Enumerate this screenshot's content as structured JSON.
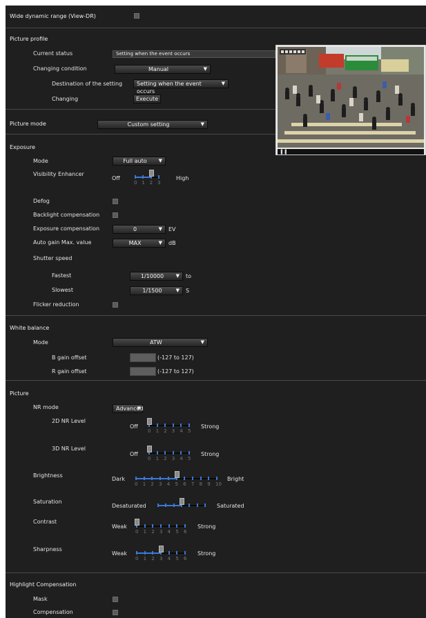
{
  "wdr": {
    "label": "Wide dynamic range (View-DR)"
  },
  "picture_profile": {
    "heading": "Picture profile",
    "current_status_label": "Current status",
    "current_status_value": "Setting when the event occurs",
    "changing_condition_label": "Changing condition",
    "changing_condition_value": "Manual",
    "destination_label": "Destination of the setting",
    "destination_value": "Setting when the event occurs",
    "changing_label": "Changing",
    "execute_button": "Execute"
  },
  "picture_mode": {
    "label": "Picture mode",
    "value": "Custom setting"
  },
  "exposure": {
    "heading": "Exposure",
    "mode_label": "Mode",
    "mode_value": "Full auto",
    "visibility_label": "Visibility Enhancer",
    "visibility_min": "Off",
    "visibility_max": "High",
    "visibility_value": 2,
    "visibility_max_value": 3,
    "defog_label": "Defog",
    "backlight_label": "Backlight compensation",
    "exp_comp_label": "Exposure compensation",
    "exp_comp_value": "0",
    "exp_comp_unit": "EV",
    "agc_label": "Auto gain Max. value",
    "agc_value": "MAX",
    "agc_unit": "dB",
    "shutter_label": "Shutter speed",
    "fastest_label": "Fastest",
    "fastest_value": "1/10000",
    "fastest_unit": "to",
    "slowest_label": "Slowest",
    "slowest_value": "1/1500",
    "slowest_unit": "S",
    "flicker_label": "Flicker reduction"
  },
  "white_balance": {
    "heading": "White balance",
    "mode_label": "Mode",
    "mode_value": "ATW",
    "b_gain_label": "B gain offset",
    "r_gain_label": "R gain offset",
    "range_text": "(-127 to 127)"
  },
  "picture": {
    "heading": "Picture",
    "nr_mode_label": "NR mode",
    "nr_mode_value": "Advanced",
    "nr2d_label": "2D NR Level",
    "nr2d_min": "Off",
    "nr2d_max": "Strong",
    "nr2d_value": 0,
    "nr2d_max_value": 5,
    "nr3d_label": "3D NR Level",
    "nr3d_min": "Off",
    "nr3d_max": "Strong",
    "nr3d_value": 0,
    "nr3d_max_value": 5,
    "brightness_label": "Brightness",
    "brightness_min": "Dark",
    "brightness_max": "Bright",
    "brightness_value": 5,
    "brightness_max_value": 10,
    "saturation_label": "Saturation",
    "saturation_min": "Desaturated",
    "saturation_max": "Saturated",
    "saturation_value": 3,
    "saturation_max_value": 6,
    "contrast_label": "Contrast",
    "contrast_min": "Weak",
    "contrast_max": "Strong",
    "contrast_value": 0,
    "contrast_max_value": 6,
    "sharpness_label": "Sharpness",
    "sharpness_min": "Weak",
    "sharpness_max": "Strong",
    "sharpness_value": 3,
    "sharpness_max_value": 6
  },
  "highlight": {
    "heading": "Highlight Compensation",
    "mask_label": "Mask",
    "compensation_label": "Compensation"
  },
  "colors": {
    "panel_bg": "#1f1f1f",
    "slider_accent": "#3a79d8",
    "checkbox": "#5a5a5a"
  }
}
